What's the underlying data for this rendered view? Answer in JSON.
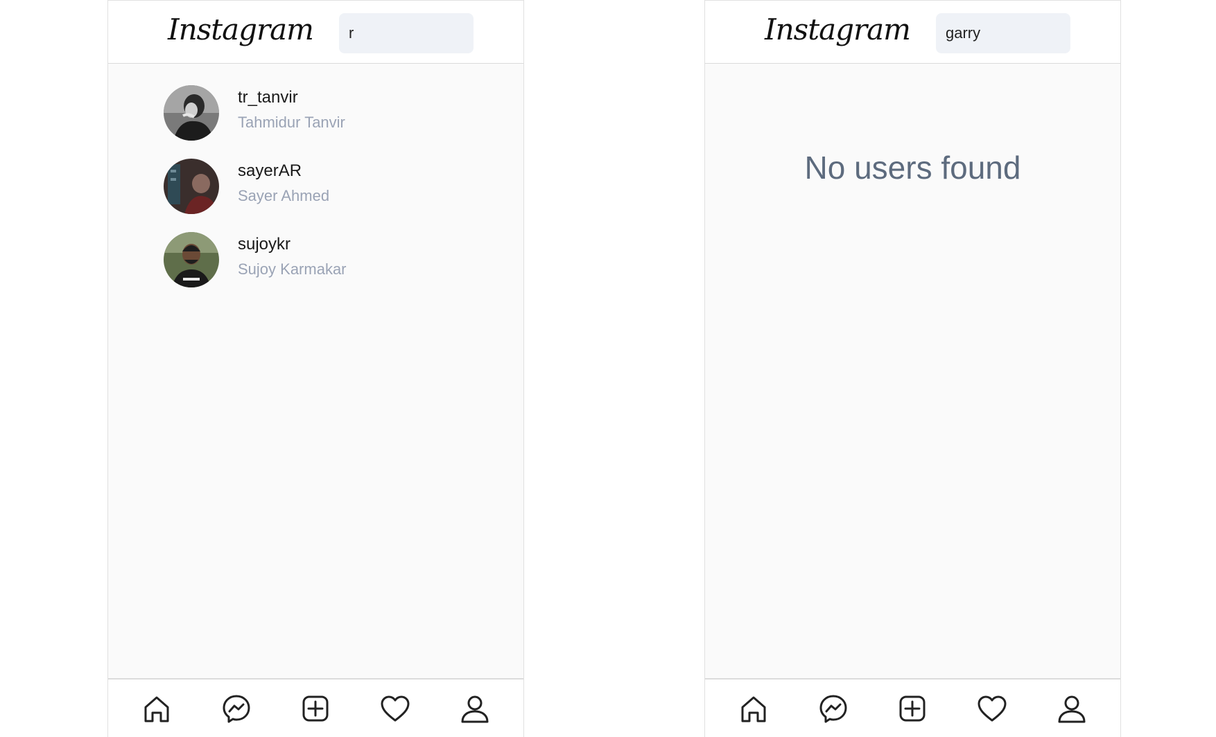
{
  "left_screen": {
    "logo": "Instagram",
    "search_value": "r",
    "results": [
      {
        "username": "tr_tanvir",
        "full_name": "Tahmidur Tanvir",
        "avatar": "avatar-photo-bw"
      },
      {
        "username": "sayerAR",
        "full_name": "Sayer Ahmed",
        "avatar": "avatar-photo-dark"
      },
      {
        "username": "sujoykr",
        "full_name": "Sujoy Karmakar",
        "avatar": "avatar-photo-green"
      }
    ],
    "nav_icons": [
      "home-icon",
      "messenger-icon",
      "add-post-icon",
      "heart-icon",
      "profile-icon"
    ]
  },
  "right_screen": {
    "logo": "Instagram",
    "search_value": "garry",
    "empty_message": "No users found",
    "nav_icons": [
      "home-icon",
      "messenger-icon",
      "add-post-icon",
      "heart-icon",
      "profile-icon"
    ]
  },
  "colors": {
    "background": "#fafafa",
    "search_bg": "#eff2f7",
    "secondary_text": "#9aa3b5",
    "empty_text": "#5d6b7e",
    "border": "#dbdbdb"
  }
}
